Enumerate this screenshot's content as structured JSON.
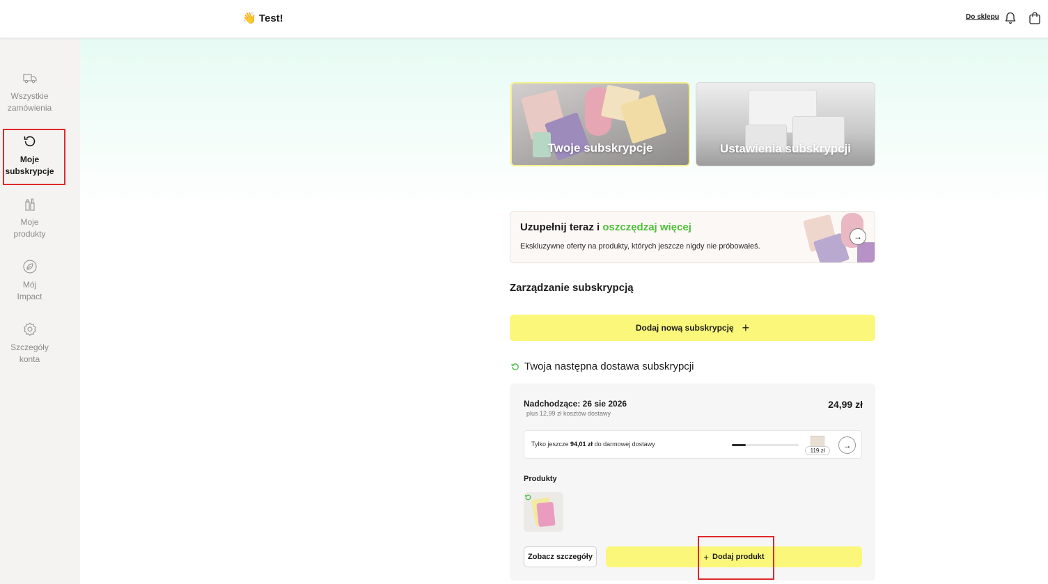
{
  "header": {
    "greeting_emoji": "👋",
    "greeting": "Test!",
    "shop_link": "Do sklepu",
    "icons": [
      "bell-icon",
      "cart-icon"
    ]
  },
  "sidebar": {
    "items": [
      {
        "label_line1": "Wszystkie",
        "label_line2": "zamówienia",
        "icon": "truck-icon",
        "active": false
      },
      {
        "label_line1": "Moje",
        "label_line2": "subskrypcje",
        "icon": "refresh-icon",
        "active": true
      },
      {
        "label_line1": "Moje",
        "label_line2": "produkty",
        "icon": "bottles-icon",
        "active": false
      },
      {
        "label_line1": "Mój",
        "label_line2": "Impact",
        "icon": "leaf-icon",
        "active": false
      },
      {
        "label_line1": "Szczegóły",
        "label_line2": "konta",
        "icon": "gear-icon",
        "active": false
      }
    ]
  },
  "cards": {
    "subscriptions": "Twoje subskrypcje",
    "settings": "Ustawienia subskrypcji"
  },
  "promo": {
    "title_part1": "Uzupełnij teraz i ",
    "title_part2": "oszczędzaj więcej",
    "subtitle": "Ekskluzywne oferty na produkty, których jeszcze nigdy nie próbowałeś.",
    "arrow": "→"
  },
  "management": {
    "title": "Zarządzanie subskrypcją",
    "add_button": "Dodaj nową subskrypcję",
    "add_plus": "+"
  },
  "next_delivery": {
    "title": "Twoja następna dostawa subskrypcji",
    "upcoming": "Nadchodzące: 26 sie 2026",
    "shipping": "plus 12,99 zł kosztów dostawy",
    "price": "24,99 zł",
    "free_shipping_prefix": "Tylko jeszcze ",
    "free_shipping_amount": "94,01 zł",
    "free_shipping_suffix": " do darmowej dostawy",
    "free_shipping_progress": 0.21,
    "threshold_badge": "119 zł",
    "arrow": "→",
    "products_label": "Produkty",
    "details_button": "Zobacz szczegóły",
    "add_product_button": "Dodaj produkt",
    "add_product_plus": "+"
  },
  "colors": {
    "accent_yellow": "#fbf77a",
    "accent_green": "#4fbf3a",
    "highlight_red": "#e0282a"
  }
}
